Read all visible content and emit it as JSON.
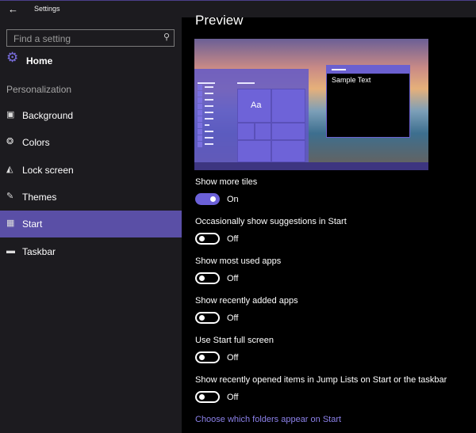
{
  "window": {
    "title": "Settings",
    "back_icon": "arrow-left-icon"
  },
  "sidebar": {
    "search_placeholder": "Find a setting",
    "home": "Home",
    "section": "Personalization",
    "items": [
      {
        "label": "Background",
        "icon": "picture-icon"
      },
      {
        "label": "Colors",
        "icon": "palette-icon"
      },
      {
        "label": "Lock screen",
        "icon": "lock-screen-icon"
      },
      {
        "label": "Themes",
        "icon": "themes-icon"
      },
      {
        "label": "Start",
        "icon": "start-tiles-icon",
        "active": true
      },
      {
        "label": "Taskbar",
        "icon": "taskbar-icon"
      }
    ]
  },
  "main": {
    "preview_title": "Preview",
    "preview": {
      "tile_text": "Aa",
      "sample_text": "Sample Text"
    },
    "options": [
      {
        "label": "Show more tiles",
        "state": "On",
        "on": true
      },
      {
        "label": "Occasionally show suggestions in Start",
        "state": "Off",
        "on": false
      },
      {
        "label": "Show most used apps",
        "state": "Off",
        "on": false
      },
      {
        "label": "Show recently added apps",
        "state": "Off",
        "on": false
      },
      {
        "label": "Use Start full screen",
        "state": "Off",
        "on": false
      },
      {
        "label": "Show recently opened items in Jump Lists on Start or the taskbar",
        "state": "Off",
        "on": false
      }
    ],
    "link": "Choose which folders appear on Start"
  },
  "colors": {
    "accent": "#5a4fa6",
    "toggle_on": "#6b60d8",
    "link": "#8b80e8"
  }
}
